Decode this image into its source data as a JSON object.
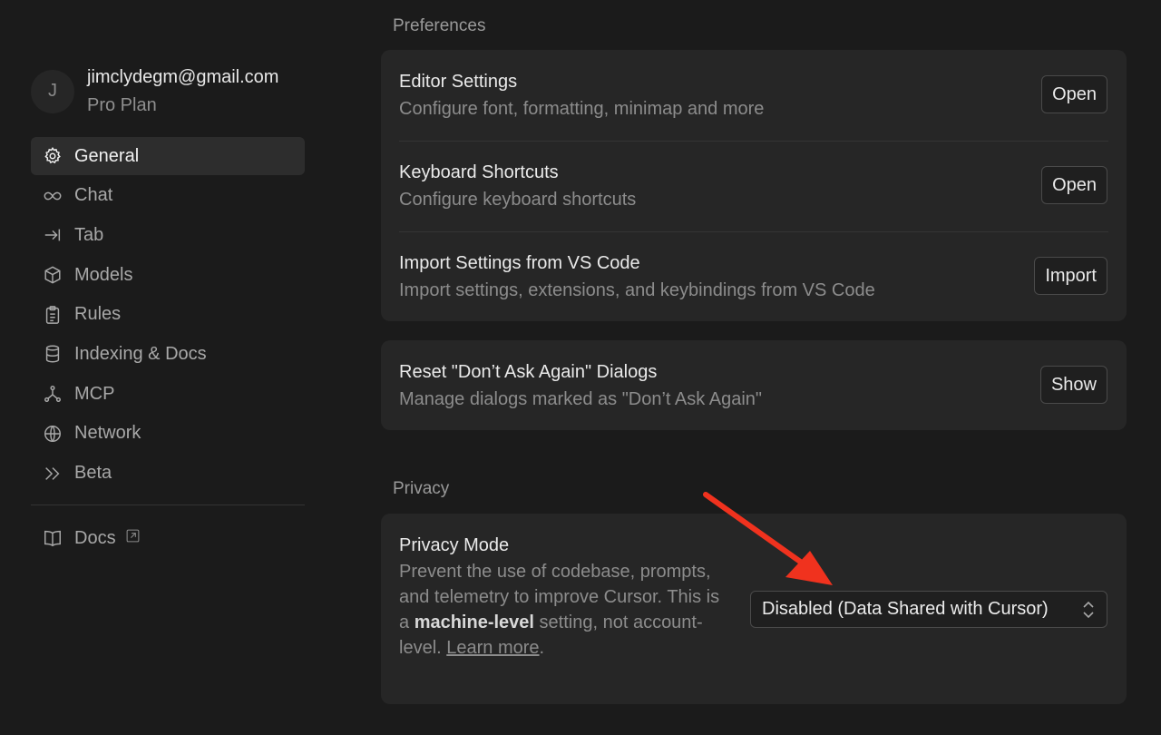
{
  "account": {
    "avatar_initial": "J",
    "email": "jimclydegm@gmail.com",
    "plan": "Pro Plan"
  },
  "sidebar": {
    "items": [
      {
        "label": "General",
        "icon": "gear-icon"
      },
      {
        "label": "Chat",
        "icon": "infinity-icon"
      },
      {
        "label": "Tab",
        "icon": "arrow-to-line-icon"
      },
      {
        "label": "Models",
        "icon": "cube-icon"
      },
      {
        "label": "Rules",
        "icon": "clipboard-icon"
      },
      {
        "label": "Indexing & Docs",
        "icon": "database-icon"
      },
      {
        "label": "MCP",
        "icon": "nodes-icon"
      },
      {
        "label": "Network",
        "icon": "globe-icon"
      },
      {
        "label": "Beta",
        "icon": "double-chevron-icon"
      }
    ],
    "docs": {
      "label": "Docs",
      "icon": "book-icon",
      "ext_icon": "external-link-icon"
    }
  },
  "preferences": {
    "title": "Preferences",
    "rows": [
      {
        "title": "Editor Settings",
        "desc": "Configure font, formatting, minimap and more",
        "button": "Open"
      },
      {
        "title": "Keyboard Shortcuts",
        "desc": "Configure keyboard shortcuts",
        "button": "Open"
      },
      {
        "title": "Import Settings from VS Code",
        "desc": "Import settings, extensions, and keybindings from VS Code",
        "button": "Import"
      }
    ],
    "reset": {
      "title": "Reset \"Don’t Ask Again\" Dialogs",
      "desc": "Manage dialogs marked as \"Don’t Ask Again\"",
      "button": "Show"
    }
  },
  "privacy": {
    "title": "Privacy",
    "mode_title": "Privacy Mode",
    "desc_pre": "Prevent the use of codebase, prompts, and telemetry to improve Cursor. This is a ",
    "desc_bold": "machine-level",
    "desc_post": " setting, not account-level. ",
    "learn_more": "Learn more",
    "period": ".",
    "select_value": "Disabled (Data Shared with Cursor)"
  },
  "colors": {
    "annotation_arrow": "#f0321e"
  }
}
